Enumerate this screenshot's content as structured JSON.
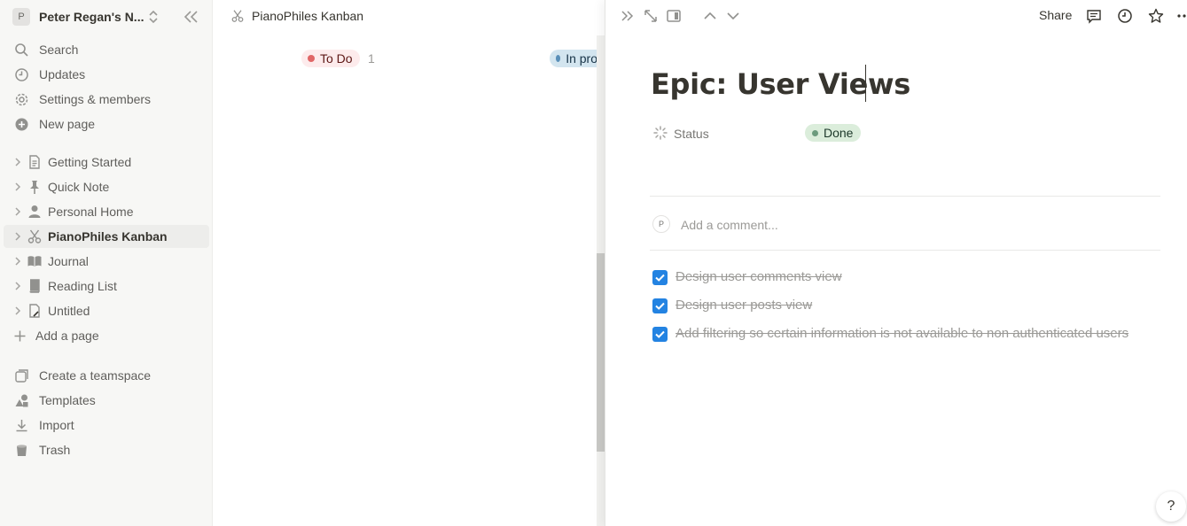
{
  "workspace": {
    "avatar_letter": "P",
    "name": "Peter Regan's N..."
  },
  "sidebar": {
    "nav": [
      {
        "label": "Search",
        "icon": "search-icon"
      },
      {
        "label": "Updates",
        "icon": "clock-icon"
      },
      {
        "label": "Settings & members",
        "icon": "gear-icon"
      },
      {
        "label": "New page",
        "icon": "plus-circle-icon"
      }
    ],
    "pages": [
      {
        "label": "Getting Started",
        "icon": "document-icon"
      },
      {
        "label": "Quick Note",
        "icon": "pin-icon"
      },
      {
        "label": "Personal Home",
        "icon": "person-icon"
      },
      {
        "label": "PianoPhiles Kanban",
        "icon": "scissors-icon",
        "active": true
      },
      {
        "label": "Journal",
        "icon": "book-open-icon"
      },
      {
        "label": "Reading List",
        "icon": "book-icon"
      },
      {
        "label": "Untitled",
        "icon": "document-edit-icon"
      }
    ],
    "add_page": "Add a page",
    "bottom": [
      {
        "label": "Create a teamspace",
        "icon": "teamspace-icon"
      },
      {
        "label": "Templates",
        "icon": "shapes-icon"
      },
      {
        "label": "Import",
        "icon": "download-icon"
      },
      {
        "label": "Trash",
        "icon": "trash-icon"
      }
    ]
  },
  "board": {
    "breadcrumb": "PianoPhiles Kanban",
    "groups": [
      {
        "label": "To Do",
        "count": "1",
        "color": "#e06666"
      },
      {
        "label": "In progress",
        "visible_label": "In pro",
        "color": "#5a8fb8"
      }
    ]
  },
  "peek": {
    "share_label": "Share",
    "title": "Epic: User Views",
    "property": {
      "label": "Status",
      "value": "Done",
      "value_color": "#dbeddb"
    },
    "comment": {
      "avatar_letter": "P",
      "placeholder": "Add a comment..."
    },
    "todos": [
      {
        "text": "Design user comments view",
        "checked": true
      },
      {
        "text": "Design user posts view",
        "checked": true
      },
      {
        "text": "Add filtering so certain information is not available to non authenticated users",
        "checked": true
      }
    ],
    "help_label": "?"
  },
  "colors": {
    "accent": "#2383e2",
    "sidebar_bg": "#f7f7f5"
  }
}
